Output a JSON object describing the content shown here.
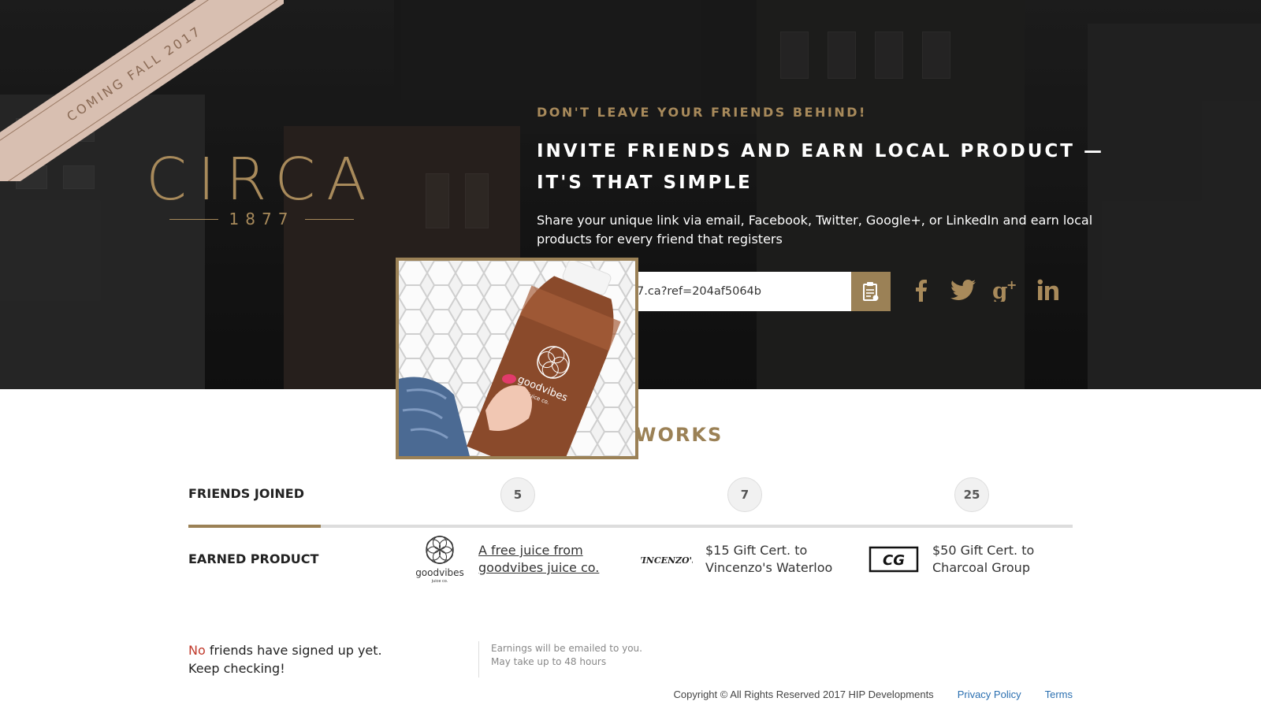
{
  "ribbon": {
    "text": "COMING FALL 2017"
  },
  "logo": {
    "main": "CIRCA",
    "year": "1877"
  },
  "hero": {
    "kicker": "DON'T LEAVE YOUR FRIENDS BEHIND!",
    "headline": "INVITE FRIENDS AND EARN LOCAL PRODUCT — IT'S THAT SIMPLE",
    "description": "Share your unique link via email, Facebook, Twitter, Google+, or LinkedIn and earn local products for every friend that registers",
    "link_value": "7.ca?ref=204af5064b",
    "copy_icon": "clipboard-icon",
    "socials": [
      "facebook-icon",
      "twitter-icon",
      "google-plus-icon",
      "linkedin-icon"
    ]
  },
  "photo": {
    "brand_text": "goodvibes",
    "brand_sub": "juice co."
  },
  "how_it_works": {
    "title_visible": "WORKS"
  },
  "friends": {
    "label": "FRIENDS JOINED",
    "counts": [
      "5",
      "7",
      "25"
    ],
    "progress": 0.15
  },
  "earned": {
    "label": "EARNED PRODUCT",
    "rewards": [
      {
        "logo_text": "goodvibes",
        "logo_sub": "juice co.",
        "text": "A free juice from goodvibes juice co."
      },
      {
        "logo_text": "VINCENZO'S",
        "text": "$15 Gift Cert. to Vincenzo's Waterloo"
      },
      {
        "logo_text": "CG",
        "text": "$50 Gift Cert. to Charcoal Group"
      }
    ]
  },
  "status": {
    "no": "No",
    "rest": " friends have signed up yet.",
    "line2": "Keep checking!"
  },
  "note": {
    "line1": "Earnings will be emailed to you.",
    "line2": "May take up to 48 hours"
  },
  "footer": {
    "copyright": "Copyright © All Rights Reserved 2017 HIP Developments",
    "privacy": "Privacy Policy",
    "terms": "Terms"
  },
  "colors": {
    "gold": "#9b8156",
    "ribbon": "#d8bfb1",
    "red": "#c0392b"
  }
}
